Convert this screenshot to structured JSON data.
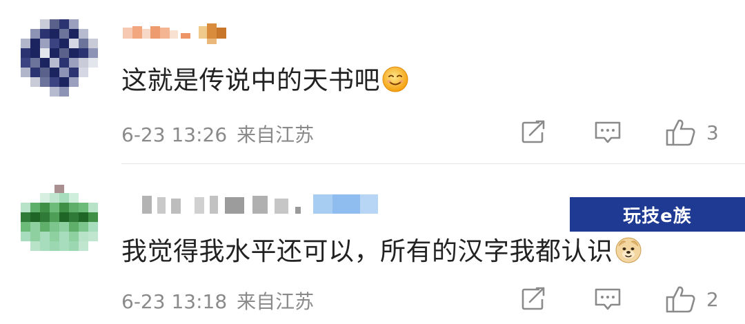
{
  "comments": [
    {
      "text": "这就是传说中的天书吧",
      "emoji": "smile-emoji",
      "time": "6-23 13:26",
      "location": "来自江苏",
      "likes": "3"
    },
    {
      "text": "我觉得我水平还可以，所有的汉字我都认识",
      "emoji": "doge-emoji",
      "time": "6-23 13:18",
      "location": "来自江苏",
      "likes": "2"
    }
  ],
  "icons": {
    "repost": "repost-icon",
    "reply": "comment-icon",
    "like": "thumbs-up-icon"
  },
  "watermark": {
    "text": "玩技e族"
  },
  "colors": {
    "text": "#222222",
    "meta": "#8a8a8a",
    "icon": "#8a8a8a",
    "divider": "#e6e6e6",
    "watermark_bg": "#1f3a93"
  }
}
